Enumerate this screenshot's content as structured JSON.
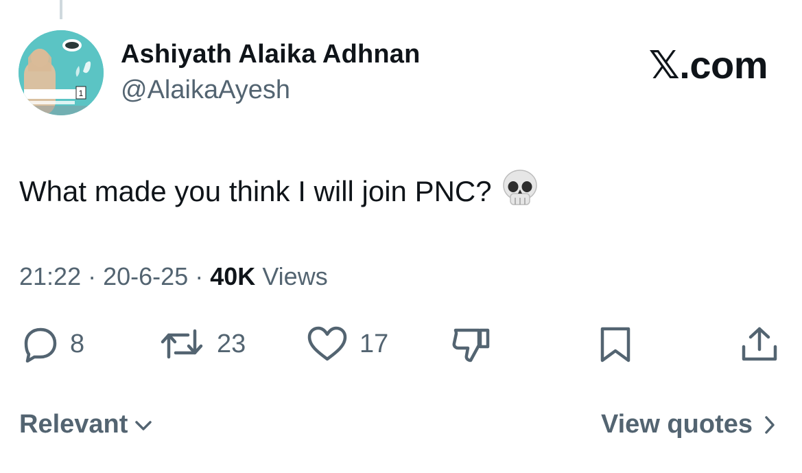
{
  "author": {
    "display_name": "Ashiyath Alaika Adhnan",
    "handle": "@AlaikaAyesh",
    "avatar_badge": "1"
  },
  "brand": "𝕏.com",
  "tweet": {
    "text": "What made you think I will join PNC?",
    "emoji": "skull"
  },
  "meta": {
    "time": "21:22",
    "date": "20-6-25",
    "views_count": "40K",
    "views_label": "Views",
    "separator": "·"
  },
  "actions": {
    "replies": "8",
    "reposts": "23",
    "likes": "17"
  },
  "footer": {
    "sort_label": "Relevant",
    "quotes_label": "View quotes"
  },
  "colors": {
    "text": "#0f1419",
    "secondary": "#536471",
    "avatar_bg": "#5bc4c4"
  }
}
